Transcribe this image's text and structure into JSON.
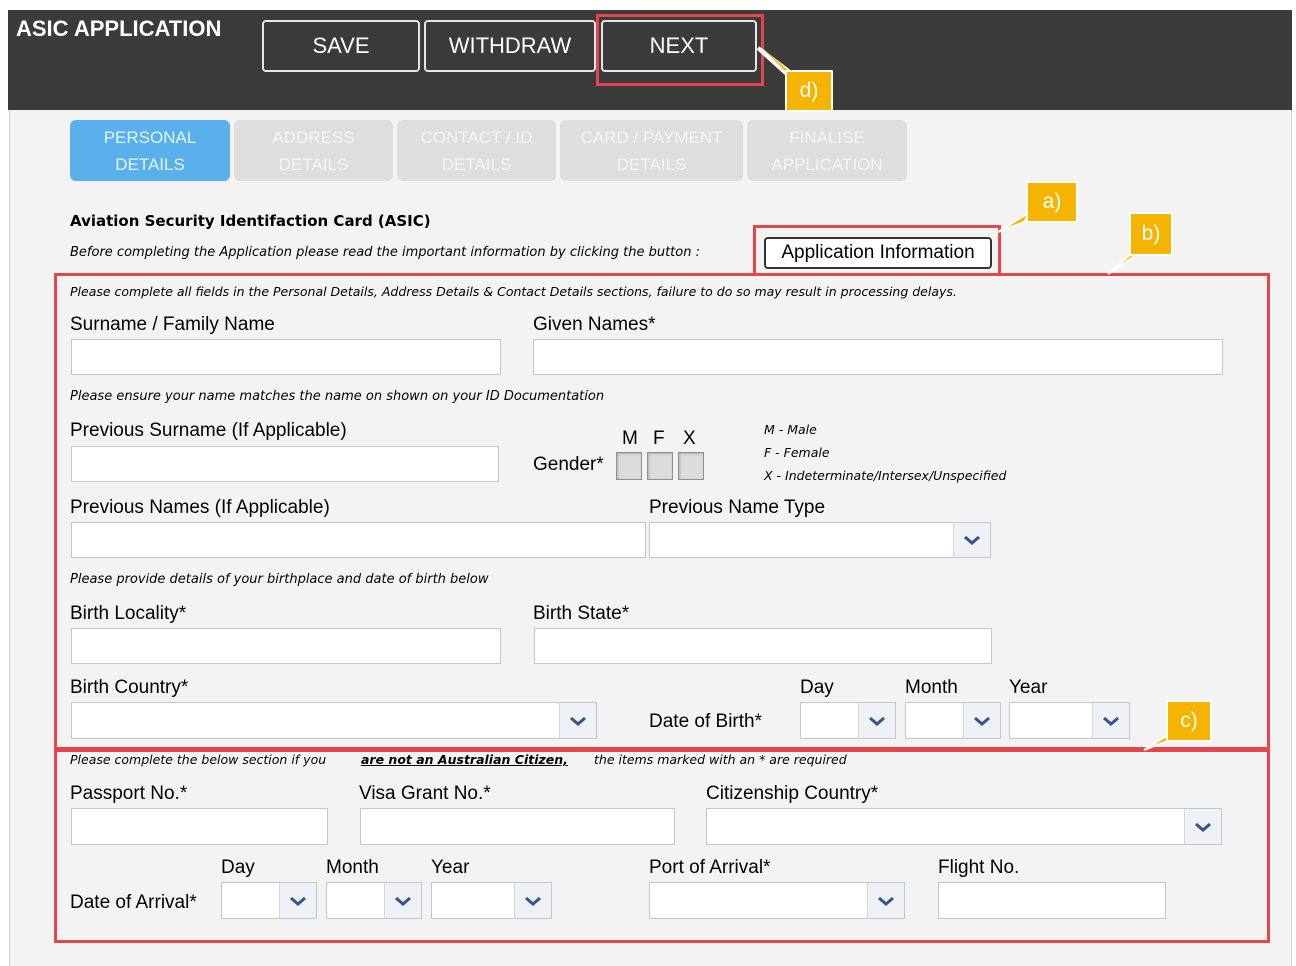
{
  "header": {
    "title": "ASIC APPLICATION",
    "save_label": "SAVE",
    "withdraw_label": "WITHDRAW",
    "next_label": "NEXT",
    "bg_color": "#3b3b3b"
  },
  "tabs": [
    {
      "line1": "PERSONAL",
      "line2": "DETAILS",
      "active": true
    },
    {
      "line1": "ADDRESS",
      "line2": "DETAILS",
      "active": false
    },
    {
      "line1": "CONTACT / ID",
      "line2": "DETAILS",
      "active": false
    },
    {
      "line1": "CARD / PAYMENT",
      "line2": "DETAILS",
      "active": false
    },
    {
      "line1": "FINALISE",
      "line2": "APPLICATION",
      "active": false
    }
  ],
  "intro": {
    "card_title": "Aviation Security Identifaction Card (ASIC)",
    "read_info_text": "Before completing the Application please read the important information by clicking the button :",
    "app_info_button": "Application Information",
    "complete_note": "Please complete all fields in the Personal Details, Address Details & Contact Details sections, failure to do so may result in processing delays."
  },
  "personal": {
    "surname_label": "Surname / Family Name",
    "surname_value": "",
    "given_names_label": "Given Names*",
    "given_names_value": "",
    "name_match_note": "Please ensure your name matches the name on shown on your ID Documentation",
    "prev_surname_label": "Previous Surname (If Applicable)",
    "gender_label": "Gender*",
    "gender_options": [
      "M",
      "F",
      "X"
    ],
    "gender_legend": [
      "M - Male",
      "F - Female",
      "X - Indeterminate/Intersex/Unspecified"
    ],
    "prev_names_label": "Previous Names (If Applicable)",
    "prev_name_type_label": "Previous Name Type",
    "birth_note": "Please provide details of your birthplace and date of birth below",
    "birth_locality_label": "Birth Locality*",
    "birth_state_label": "Birth State*",
    "birth_country_label": "Birth Country*",
    "dob_label": "Date of Birth*",
    "day_label": "Day",
    "month_label": "Month",
    "year_label": "Year"
  },
  "non_citizen": {
    "note_prefix": "Please complete the below section if you",
    "note_emph": "are not an Australian Citizen,",
    "note_suffix": "the items marked with an * are required",
    "passport_label": "Passport No.*",
    "visa_label": "Visa Grant No.*",
    "citizenship_label": "Citizenship Country*",
    "arrival_label": "Date of Arrival*",
    "day_label": "Day",
    "month_label": "Month",
    "year_label": "Year",
    "port_label": "Port of Arrival*",
    "flight_label": "Flight No."
  },
  "callouts": {
    "a": "a)",
    "b": "b)",
    "c": "c)",
    "d": "d)"
  },
  "colors": {
    "accent_tab": "#5ab0ea",
    "highlight_red": "#e8454b",
    "callout_yellow": "#f5b400",
    "dropdown_arrow": "#34558b"
  },
  "icons": {
    "dropdown": "chevron-down-icon"
  }
}
